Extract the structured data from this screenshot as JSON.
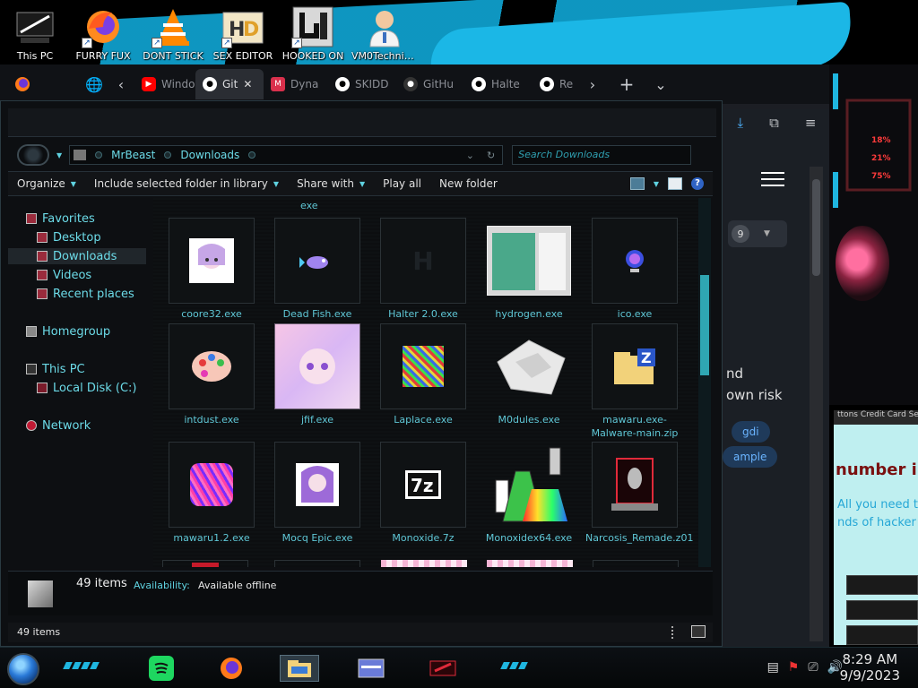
{
  "desktop": {
    "icons": [
      {
        "label": "This PC",
        "icon": "this-pc-icon"
      },
      {
        "label": "FURRY FUX",
        "icon": "firefox-icon"
      },
      {
        "label": "DONT STICK",
        "icon": "vlc-icon"
      },
      {
        "label": "SEX EDITOR",
        "icon": "hxd-editor-icon"
      },
      {
        "label": "HOOKED ON",
        "icon": "hooked-on-icon"
      },
      {
        "label": "VM0Technic...",
        "icon": "doctor-icon"
      }
    ]
  },
  "browser": {
    "tabs": [
      {
        "label": "Windo",
        "icon": "youtube"
      },
      {
        "label": "Git",
        "icon": "github",
        "active": true
      },
      {
        "label": "Dyna",
        "icon": "m"
      },
      {
        "label": "SKIDD",
        "icon": "github"
      },
      {
        "label": "GitHu",
        "icon": "github"
      },
      {
        "label": "Halte",
        "icon": "github"
      },
      {
        "label": "Re",
        "icon": "github"
      }
    ],
    "nav_back": "‹",
    "nav_forward": "›",
    "new_tab": "+",
    "tab_list": "⌄",
    "close_tab": "✕",
    "side": {
      "badge_number": "9",
      "text_line1": "nd",
      "text_line2": "own risk",
      "tag1": "gdi",
      "tag2": "ample"
    }
  },
  "widgets": {
    "gauges": [
      "18%",
      "21%",
      "75%"
    ],
    "web_header": "ttons Credit Card Se",
    "big_text": "number in",
    "small_text1": "All you need t",
    "small_text2": "nds of hacker"
  },
  "explorer": {
    "breadcrumb": [
      "MrBeast",
      "Downloads"
    ],
    "search_placeholder": "Search Downloads",
    "toolbar": {
      "organize": "Organize",
      "include": "Include selected folder in library",
      "share": "Share with",
      "play_all": "Play all",
      "new_folder": "New folder"
    },
    "nav": {
      "favorites": "Favorites",
      "desktop": "Desktop",
      "downloads": "Downloads",
      "videos": "Videos",
      "recent": "Recent places",
      "homegroup": "Homegroup",
      "this_pc": "This PC",
      "local_disk": "Local Disk (C:)",
      "network": "Network"
    },
    "partial_top_label": "exe",
    "files": [
      {
        "name": "coore32.exe",
        "art": "anime-girl"
      },
      {
        "name": "Dead Fish.exe",
        "art": "fish"
      },
      {
        "name": "Halter 2.0.exe",
        "art": "halter"
      },
      {
        "name": "hydrogen.exe",
        "art": "window-preview"
      },
      {
        "name": "ico.exe",
        "art": "globe"
      },
      {
        "name": "intdust.exe",
        "art": "palette"
      },
      {
        "name": "jfif.exe",
        "art": "pink-anime"
      },
      {
        "name": "Laplace.exe",
        "art": "rainbow-noise"
      },
      {
        "name": "M0dules.exe",
        "art": "white-cube"
      },
      {
        "name": "mawaru.exe-Malware-main.zip",
        "art": "zip-folder"
      },
      {
        "name": "mawaru1.2.exe",
        "art": "pink-noise"
      },
      {
        "name": "Mocq Epic.exe",
        "art": "anime-girl2"
      },
      {
        "name": "Monoxide.7z",
        "art": "7z"
      },
      {
        "name": "Monoxidex64.exe",
        "art": "flasks"
      },
      {
        "name": "Narcosis_Remade.z01",
        "art": "alienware"
      }
    ],
    "status": {
      "count": "49 items",
      "availability_label": "Availability:",
      "availability_value": "Available offline",
      "bottom_count": "49 items"
    }
  },
  "taskbar": {
    "time": "8:29 AM",
    "date": "9/9/2023",
    "buttons": [
      "spotify-icon",
      "firefox-icon",
      "file-explorer-icon",
      "app-window-icon",
      "alienware-app-icon"
    ]
  }
}
